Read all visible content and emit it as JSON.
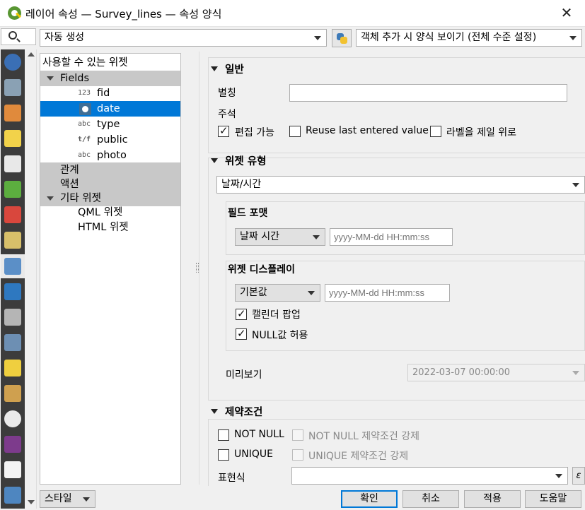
{
  "window": {
    "title": "레이어 속성 — Survey_lines — 속성 양식",
    "close_glyph": "✕"
  },
  "toolbar": {
    "layout_mode": "자동 생성",
    "form_suppress": "객체 추가 시 양식 보이기 (전체 수준 설정)"
  },
  "available_widgets": {
    "header": "사용할 수 있는 위젯",
    "fields_label": "Fields",
    "fields": [
      {
        "type_icon": "123",
        "name": "fid"
      },
      {
        "type_icon": "clock-icon",
        "name": "date"
      },
      {
        "type_icon": "abc",
        "name": "type"
      },
      {
        "type_icon": "t/f",
        "name": "public"
      },
      {
        "type_icon": "abc",
        "name": "photo"
      }
    ],
    "relations": "관계",
    "actions": "액션",
    "other_widgets": "기타 위젯",
    "other_items": [
      "QML 위젯",
      "HTML 위젯"
    ]
  },
  "general": {
    "title": "일반",
    "alias_label": "별칭",
    "alias_value": "",
    "comment_label": "주석",
    "editable": {
      "label": "편집 가능",
      "checked": true
    },
    "reuse_last": {
      "label": "Reuse last entered value",
      "checked": false
    },
    "label_on_top": {
      "label": "라벨을 제일 위로",
      "checked": false
    }
  },
  "widget_type": {
    "title": "위젯 유형",
    "selected": "날짜/시간",
    "field_format": {
      "title": "필드 포맷",
      "format": "날짜 시간",
      "format_placeholder": "yyyy-MM-dd HH:mm:ss"
    },
    "widget_display": {
      "title": "위젯 디스플레이",
      "format": "기본값",
      "format_placeholder": "yyyy-MM-dd HH:mm:ss",
      "calendar_popup": {
        "label": "캘린더 팝업",
        "checked": true
      },
      "allow_null": {
        "label": "NULL값 허용",
        "checked": true
      }
    },
    "preview_label": "미리보기",
    "preview_value": "2022-03-07 00:00:00"
  },
  "constraints": {
    "title": "제약조건",
    "not_null": {
      "label": "NOT NULL",
      "checked": false
    },
    "enforce_not_null": {
      "label": "NOT NULL 제약조건 강제",
      "checked": false
    },
    "unique": {
      "label": "UNIQUE",
      "checked": false
    },
    "enforce_unique": {
      "label": "UNIQUE 제약조건 강제",
      "checked": false
    },
    "expression_label": "표현식"
  },
  "footer": {
    "style": "스타일",
    "ok": "확인",
    "cancel": "취소",
    "apply": "적용",
    "help": "도움말"
  },
  "colors": {
    "selection": "#0078d7",
    "sidebar": "#3c3c3c",
    "group_bg": "#c8c8c8"
  }
}
